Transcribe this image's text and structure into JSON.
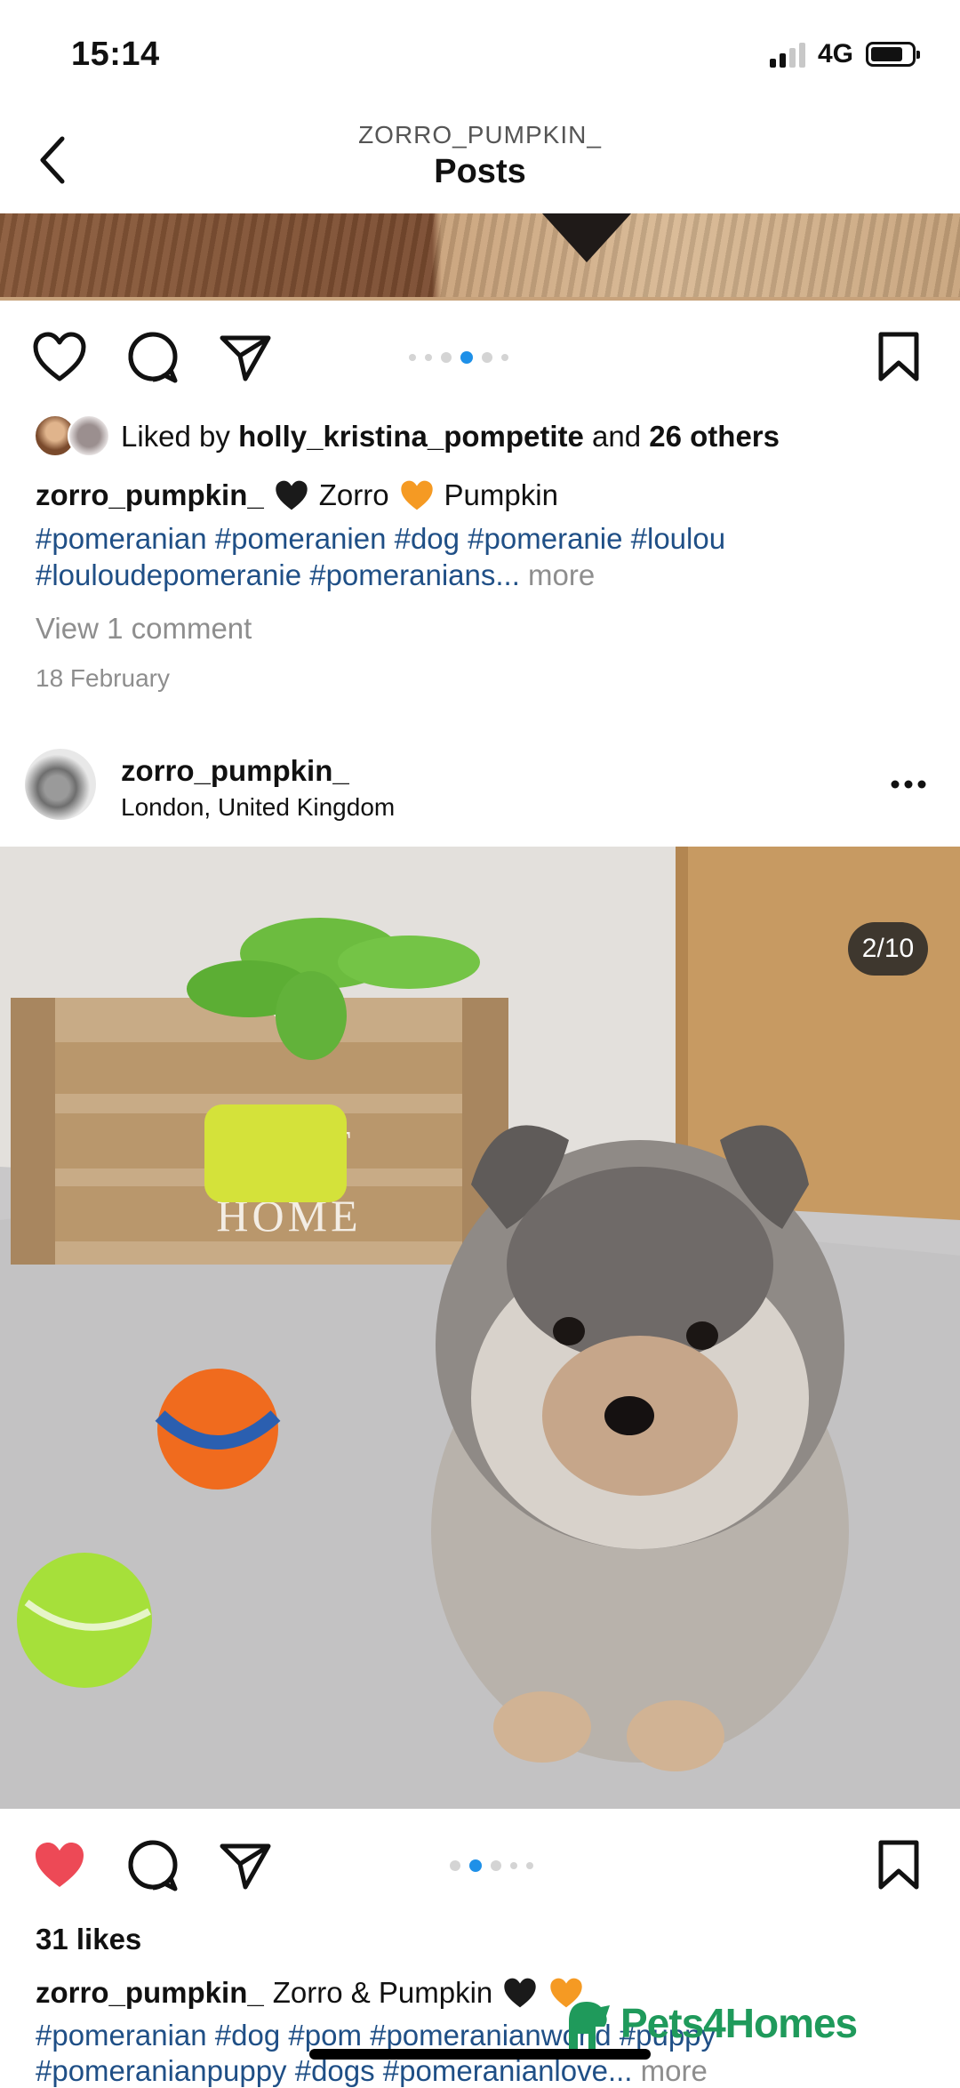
{
  "status_bar": {
    "time": "15:14",
    "network": "4G",
    "signal_bars": 4,
    "signal_active": 2,
    "battery_level": 0.8
  },
  "header": {
    "username": "ZORRO_PUMPKIN_",
    "title": "Posts",
    "back_icon": "chevron-left-icon"
  },
  "post1": {
    "carousel": {
      "count": 6,
      "active_index": 3
    },
    "liked_by_prefix": "Liked by ",
    "liked_by_user": "holly_kristina_pompetite",
    "liked_by_and": " and ",
    "liked_by_others": "26 others",
    "caption_user": "zorro_pumpkin_",
    "caption_name1": "Zorro",
    "caption_name2": "Pumpkin",
    "heart1_color": "#1a1a1a",
    "heart2_color": "#f59a23",
    "hashtags_line1": "#pomeranian #pomeranien #dog #pomeranie #loulou",
    "hashtags_line2": "#louloudepomeranie #pomeranians...",
    "more": "more",
    "view_comments": "View 1 comment",
    "date": "18 February"
  },
  "post2": {
    "username": "zorro_pumpkin_",
    "location": "London, United Kingdom",
    "menu_icon": "more-horizontal-icon",
    "image_counter": "2/10",
    "image_alt": "Fluffy blue merle Pomeranian puppy sitting on grey rug beside wooden SWEET HOME crate with toys and balls",
    "crate_text1": "SWEET",
    "crate_text2": "HOME",
    "carousel": {
      "count": 5,
      "active_index": 1
    },
    "liked": true,
    "like_color": "#ed4956",
    "likes": "31 likes",
    "caption_user": "zorro_pumpkin_",
    "caption_text": "Zorro & Pumpkin",
    "hashtags_line1": "#pomeranian #dog #pom #pomeranianworld #puppy",
    "hashtags_line2": "#pomeranianpuppy #dogs #pomeranianlove...",
    "more": "more"
  },
  "watermark": {
    "brand": "Pets4Homes",
    "color": "#1f9a5b"
  },
  "colors": {
    "accent_blue": "#1e90e8",
    "hashtag": "#1f4f86",
    "muted": "#8e8e8e"
  }
}
